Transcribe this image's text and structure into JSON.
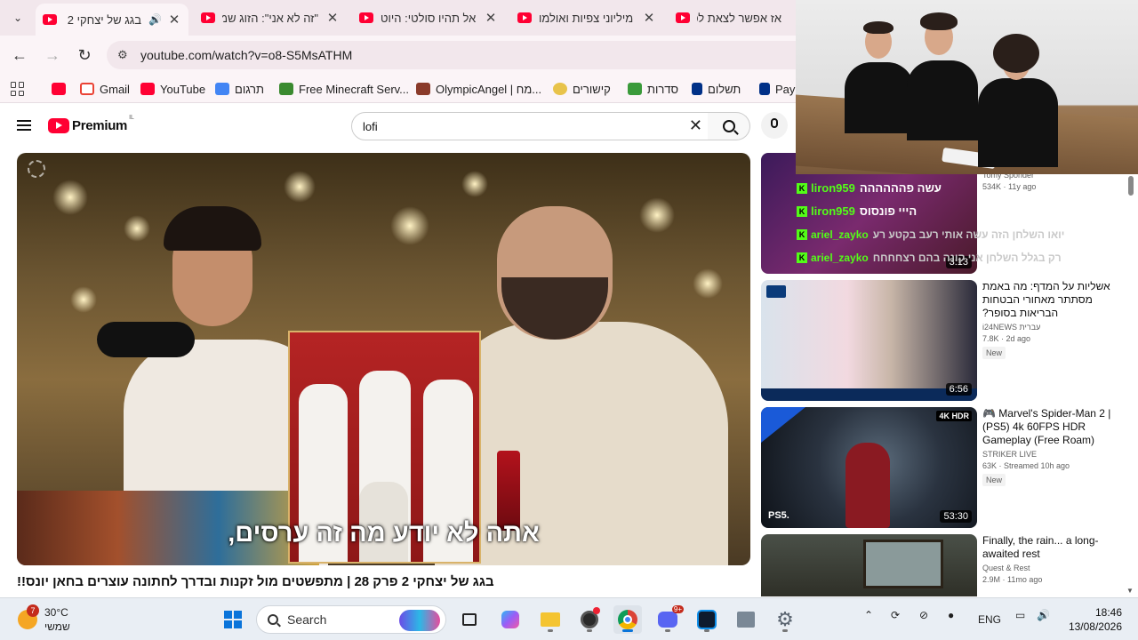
{
  "browser": {
    "tabs": [
      {
        "title": "בגג של יצחקי 2 |",
        "active": true,
        "audio": true
      },
      {
        "title": "\"זה לא אני\": הזוג שמ",
        "active": false
      },
      {
        "title": "אל תהיו סולטי: היוט",
        "active": false
      },
      {
        "title": "מיליוני צפיות ואולמו",
        "active": false
      },
      {
        "title": "אז אפשר לצאת לפנ",
        "active": false
      }
    ],
    "url": "youtube.com/watch?v=o8-S5MsATHM",
    "bookmarks": [
      {
        "label": "",
        "icon": "youtube-icon",
        "color": "#ff0033"
      },
      {
        "label": "Gmail",
        "icon": "gmail-icon",
        "color": "#ea4335"
      },
      {
        "label": "YouTube",
        "icon": "youtube-icon",
        "color": "#ff0033"
      },
      {
        "label": "תרגום",
        "icon": "translate-icon",
        "color": "#4285f4"
      },
      {
        "label": "Free Minecraft Serv...",
        "icon": "minecraft-icon",
        "color": "#3a8a2f"
      },
      {
        "label": "OlympicAngel | מח...",
        "icon": "avatar-icon",
        "color": "#8a3a2a"
      },
      {
        "label": "קישורים",
        "icon": "sparkle-icon",
        "color": "#e8c34a"
      },
      {
        "label": "סדרות",
        "icon": "tv-icon",
        "color": "#3a9a3a"
      },
      {
        "label": "תשלום",
        "icon": "paypal-icon",
        "color": "#003087"
      },
      {
        "label": "PayP",
        "icon": "paypal-icon",
        "color": "#003087"
      }
    ]
  },
  "youtube": {
    "logo_word": "Premium",
    "country_code": "IL",
    "search_query": "lofi",
    "video": {
      "subtitle": "אתה לא יודע מה זה ערסים,",
      "title": "בגג של יצחקי 2 פרק 28 | מתפשטים מול זקנות ובדרך לחתונה עוצרים בחאן יונס!!"
    },
    "chat_overlay": [
      {
        "name": "liron959",
        "msg": "עשה פהההההה"
      },
      {
        "name": "liron959",
        "msg": "הייי פונסוס"
      },
      {
        "name": "ariel_zayko",
        "msg": "יואו השלחן הזה עשה אותי רעב בקטע רע"
      },
      {
        "name": "ariel_zayko",
        "msg": "רק בגלל השלחן אני קונה בהם רצחחחח"
      }
    ],
    "recommended": [
      {
        "title": "",
        "channel": "Tomy Sponder",
        "stats": "534K · 11y ago",
        "duration": "3:13",
        "badge": ""
      },
      {
        "title": "אשליות על המדף: מה באמת מסתתר מאחורי הבטחות הבריאות בסופר?",
        "channel": "i24NEWS עברית",
        "stats": "7.8K · 2d ago",
        "duration": "6:56",
        "badge": "New"
      },
      {
        "title": "🎮 Marvel's Spider-Man 2 | (PS5) 4k 60FPS HDR Gameplay (Free Roam)",
        "channel": "STRIKER LIVE",
        "stats": "63K · Streamed 10h ago",
        "duration": "53:30",
        "badge": "New",
        "res": "4K HDR"
      },
      {
        "title": "Finally, the rain... a long-awaited rest",
        "channel": "Quest & Rest",
        "stats": "2.9M · 11mo ago",
        "duration": "",
        "badge": ""
      }
    ]
  },
  "taskbar": {
    "weather_temp": "30°C",
    "weather_desc": "שמשי",
    "weather_badge": "7",
    "search_placeholder": "Search",
    "discord_badge": "9+",
    "lang": "ENG",
    "time": "18:46",
    "date": "13/08/2026"
  }
}
